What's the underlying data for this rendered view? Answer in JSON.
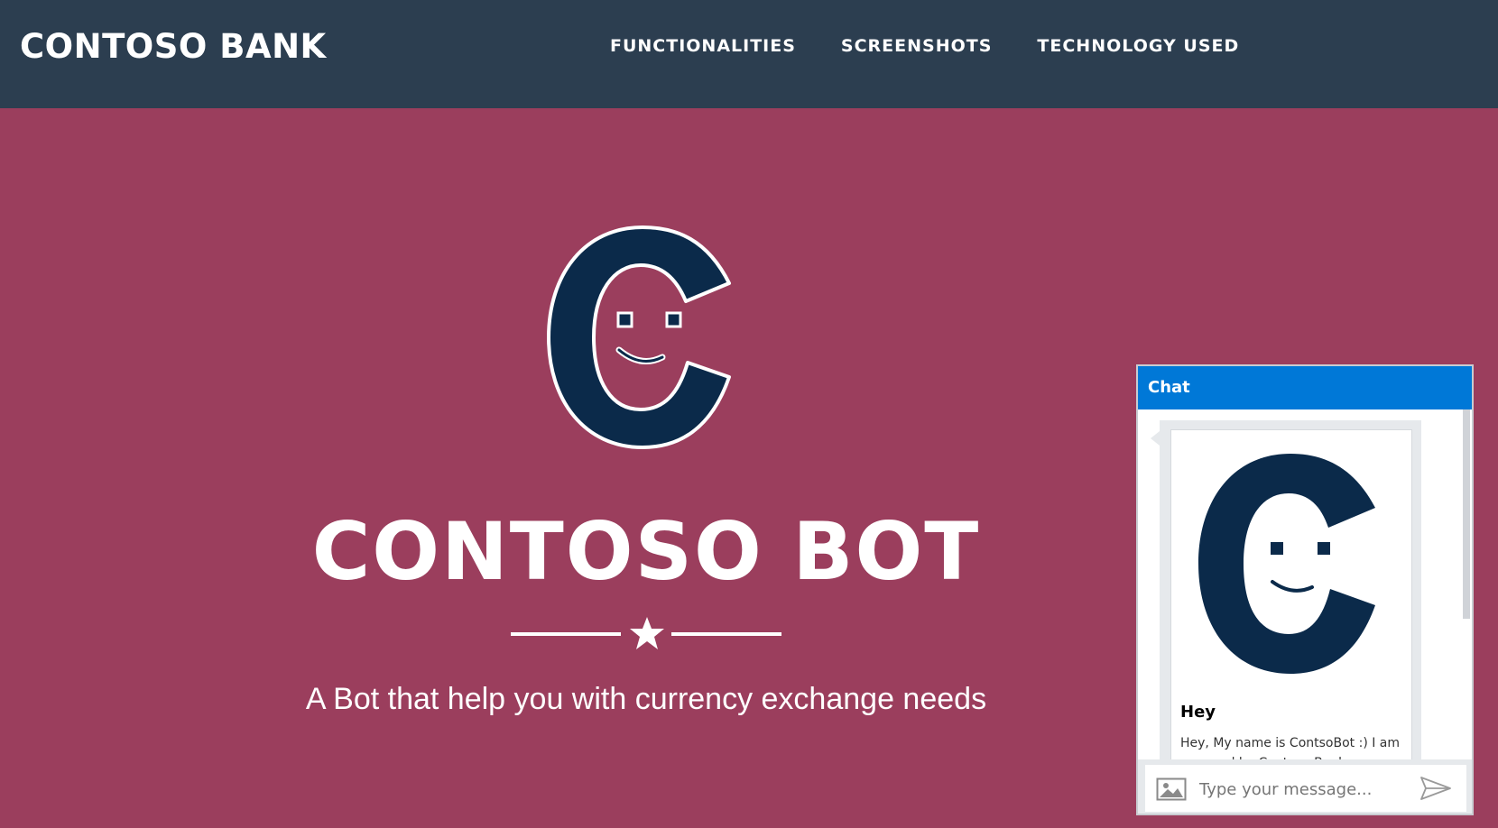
{
  "navbar": {
    "brand": "CONTOSO BANK",
    "links": [
      {
        "label": "FUNCTIONALITIES"
      },
      {
        "label": "SCREENSHOTS"
      },
      {
        "label": "TECHNOLOGY USED"
      }
    ]
  },
  "hero": {
    "logo_icon": "contoso-bot-logo-icon",
    "title": "CONTOSO BOT",
    "divider_icon": "star-icon",
    "tagline": "A Bot that help you with currency exchange needs"
  },
  "chat": {
    "header": "Chat",
    "message": {
      "image_icon": "contoso-bot-logo-icon",
      "title": "Hey",
      "text": "Hey, My name is ContsoBot :) I am powered by Contoso Bank"
    },
    "input": {
      "placeholder": "Type your message...",
      "value": ""
    },
    "upload_icon": "image-upload-icon",
    "send_icon": "send-icon"
  },
  "colors": {
    "navbar": "#2c3e50",
    "hero_background": "#9b3e5d",
    "logo_navy": "#0b2a4a",
    "chat_header": "#0078d7"
  }
}
